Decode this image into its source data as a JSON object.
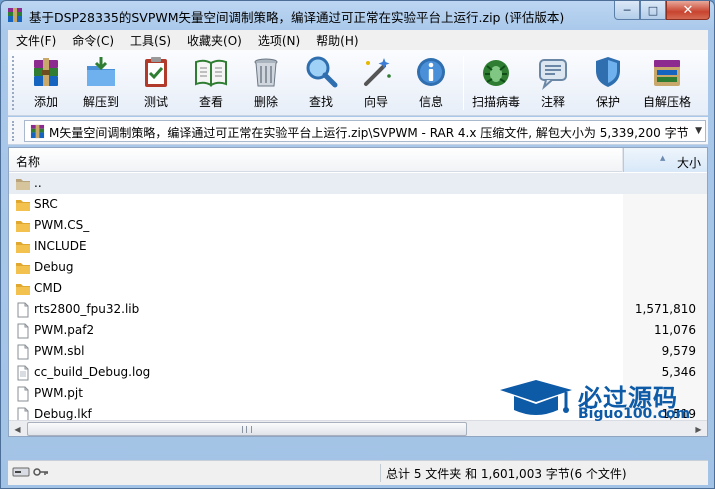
{
  "window": {
    "title": "基于DSP28335的SVPWM矢量空间调制策略，编译通过可正常在实验平台上运行.zip (评估版本)",
    "minimize": "─",
    "maximize": "□",
    "close": "✕"
  },
  "menu": {
    "items": [
      "文件(F)",
      "命令(C)",
      "工具(S)",
      "收藏夹(O)",
      "选项(N)",
      "帮助(H)"
    ]
  },
  "toolbar": {
    "add": "添加",
    "extract": "解压到",
    "test": "测试",
    "view": "查看",
    "delete": "删除",
    "find": "查找",
    "wizard": "向导",
    "info": "信息",
    "scan": "扫描病毒",
    "comment": "注释",
    "protect": "保护",
    "sfx": "自解压格"
  },
  "address": {
    "path": "M矢量空间调制策略，编译通过可正常在实验平台上运行.zip\\SVPWM - RAR 4.x 压缩文件, 解包大小为 5,339,200 字节"
  },
  "columns": {
    "name": "名称",
    "size": "大小"
  },
  "files": [
    {
      "name": "..",
      "size": "",
      "type": "parent"
    },
    {
      "name": "SRC",
      "size": "",
      "type": "folder"
    },
    {
      "name": "PWM.CS_",
      "size": "",
      "type": "folder"
    },
    {
      "name": "INCLUDE",
      "size": "",
      "type": "folder"
    },
    {
      "name": "Debug",
      "size": "",
      "type": "folder"
    },
    {
      "name": "CMD",
      "size": "",
      "type": "folder"
    },
    {
      "name": "rts2800_fpu32.lib",
      "size": "1,571,810",
      "type": "file"
    },
    {
      "name": "PWM.paf2",
      "size": "11,076",
      "type": "file"
    },
    {
      "name": "PWM.sbl",
      "size": "9,579",
      "type": "file"
    },
    {
      "name": "cc_build_Debug.log",
      "size": "5,346",
      "type": "file"
    },
    {
      "name": "PWM.pjt",
      "size": "",
      "type": "file"
    },
    {
      "name": "Debug.lkf",
      "size": "1,519",
      "type": "file"
    }
  ],
  "status": {
    "summary": "总计 5 文件夹 和 1,601,003 字节(6 个文件)"
  },
  "watermark": {
    "cn": "必过源码",
    "en": "Biguo100.com"
  },
  "colors": {
    "folder": "#f2c14e",
    "accent": "#0d5aa7",
    "close": "#c8442f"
  }
}
